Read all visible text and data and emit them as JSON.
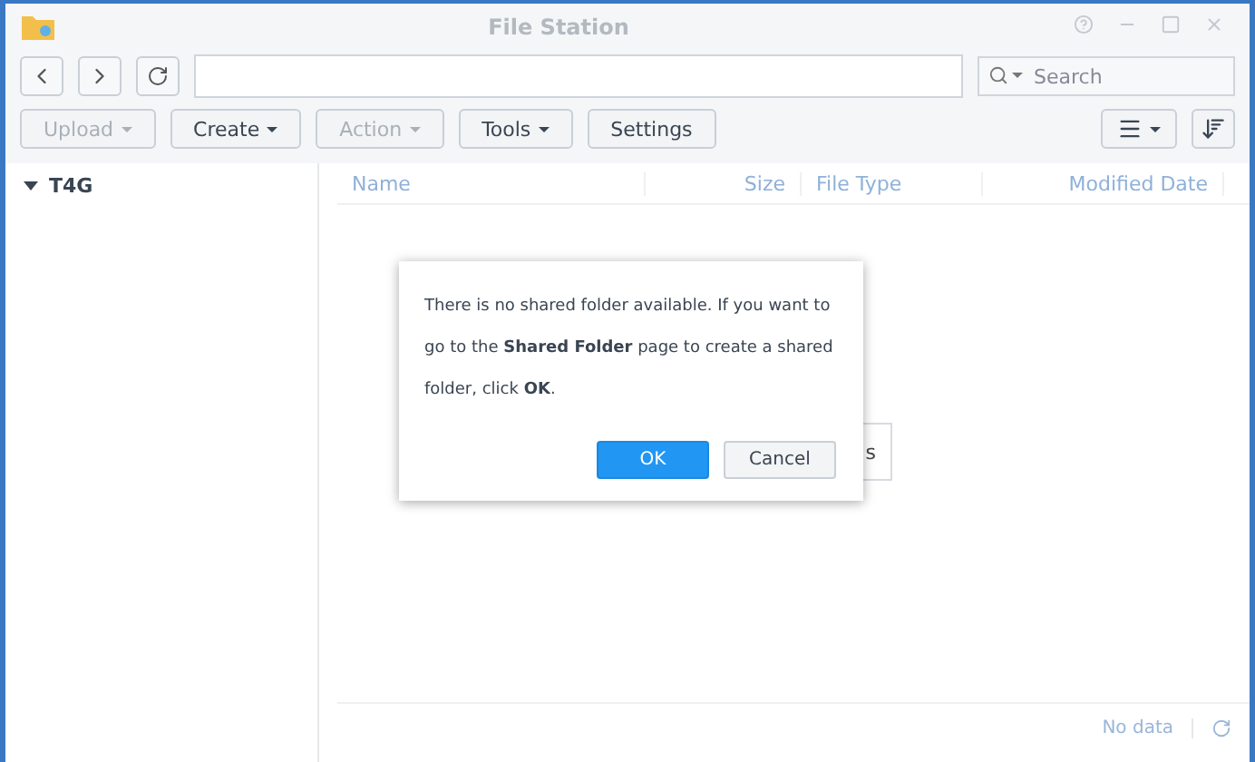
{
  "window": {
    "title": "File Station"
  },
  "navigation": {
    "search": {
      "placeholder": "Search"
    }
  },
  "toolbar": [
    {
      "label": "Upload",
      "dropdown": true,
      "disabled": true
    },
    {
      "label": "Create",
      "dropdown": true,
      "disabled": false
    },
    {
      "label": "Action",
      "dropdown": true,
      "disabled": true
    },
    {
      "label": "Tools",
      "dropdown": true,
      "disabled": false
    },
    {
      "label": "Settings",
      "dropdown": false,
      "disabled": false
    }
  ],
  "sidebar": {
    "items": [
      {
        "label": "T4G",
        "expanded": true
      }
    ]
  },
  "table": {
    "columns": [
      {
        "label": "Name"
      },
      {
        "label": "Size"
      },
      {
        "label": "File Type"
      },
      {
        "label": "Modified Date"
      }
    ]
  },
  "background_popup": {
    "text": "s"
  },
  "dialog": {
    "message": "There is no shared folder available. If you want to go to the **Shared Folder** page to create a shared folder, click **OK**.",
    "buttons": [
      {
        "label": "OK",
        "primary": true
      },
      {
        "label": "Cancel",
        "primary": false
      }
    ]
  },
  "status_bar": {
    "text": "No data"
  }
}
